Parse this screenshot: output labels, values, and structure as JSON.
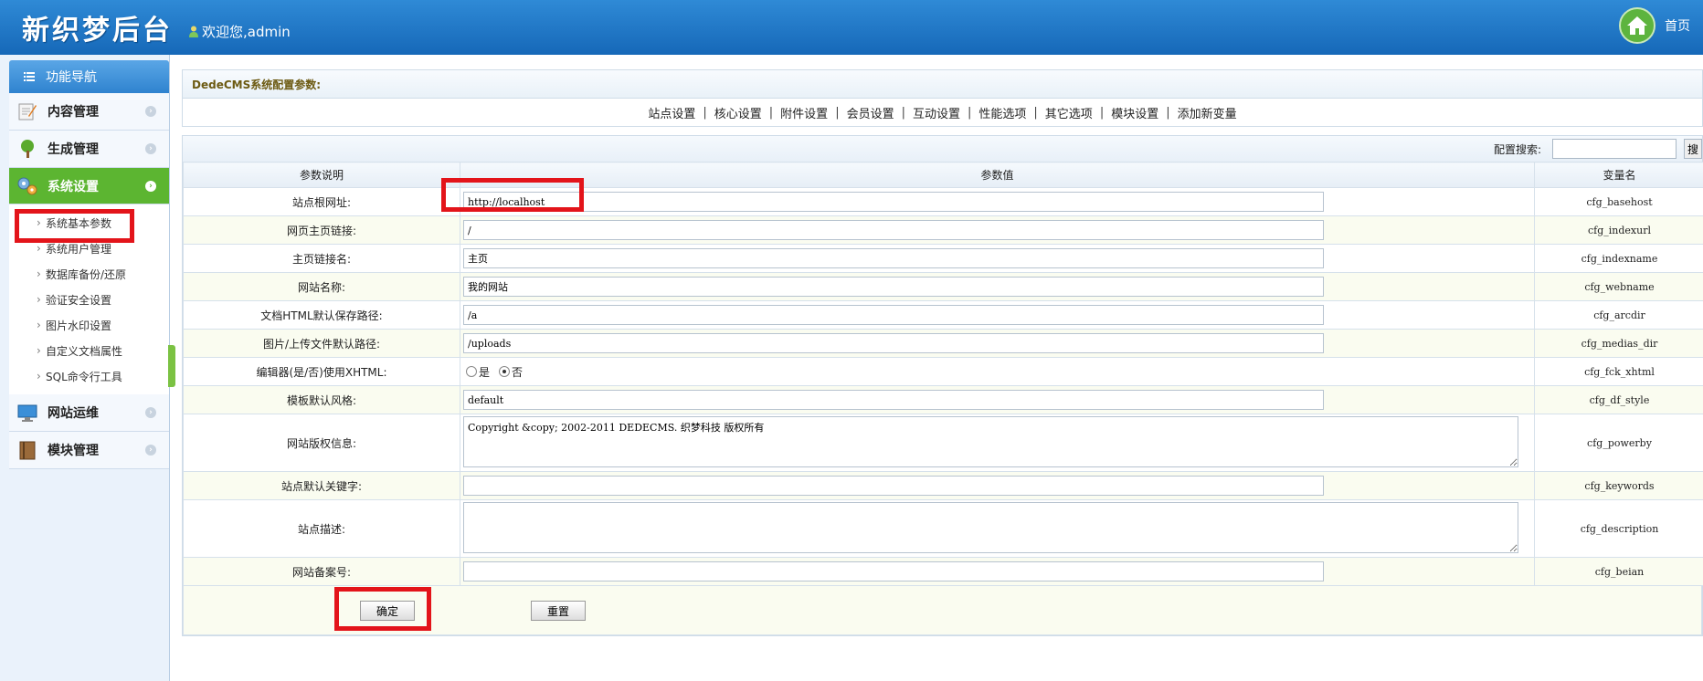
{
  "header": {
    "brand": "新织梦后台",
    "welcome": "欢迎您,admin",
    "home_label": "首页"
  },
  "sidebar": {
    "title": "功能导航",
    "items": [
      {
        "label": "内容管理",
        "icon": "notepad-icon"
      },
      {
        "label": "生成管理",
        "icon": "tree-icon"
      },
      {
        "label": "系统设置",
        "icon": "settings-icon"
      },
      {
        "label": "网站运维",
        "icon": "monitor-icon"
      },
      {
        "label": "模块管理",
        "icon": "book-icon"
      }
    ],
    "submenu": [
      "系统基本参数",
      "系统用户管理",
      "数据库备份/还原",
      "验证安全设置",
      "图片水印设置",
      "自定义文档属性",
      "SQL命令行工具"
    ]
  },
  "main": {
    "section_title": "DedeCMS系统配置参数:",
    "tabs": [
      "站点设置",
      "核心设置",
      "附件设置",
      "会员设置",
      "互动设置",
      "性能选项",
      "其它选项",
      "模块设置",
      "添加新变量"
    ],
    "search_label": "配置搜索:",
    "search_button": "搜",
    "columns": [
      "参数说明",
      "参数值",
      "变量名"
    ],
    "rows": [
      {
        "label": "站点根网址:",
        "value": "http://localhost",
        "var": "cfg_basehost"
      },
      {
        "label": "网页主页链接:",
        "value": "/",
        "var": "cfg_indexurl"
      },
      {
        "label": "主页链接名:",
        "value": "主页",
        "var": "cfg_indexname"
      },
      {
        "label": "网站名称:",
        "value": "我的网站",
        "var": "cfg_webname"
      },
      {
        "label": "文档HTML默认保存路径:",
        "value": "/a",
        "var": "cfg_arcdir"
      },
      {
        "label": "图片/上传文件默认路径:",
        "value": "/uploads",
        "var": "cfg_medias_dir"
      },
      {
        "label": "编辑器(是/否)使用XHTML:",
        "radio_yes": "是",
        "radio_no": "否",
        "selected": "否",
        "var": "cfg_fck_xhtml"
      },
      {
        "label": "模板默认风格:",
        "value": "default",
        "var": "cfg_df_style"
      },
      {
        "label": "网站版权信息:",
        "value": "Copyright &copy; 2002-2011 DEDECMS. 织梦科技 版权所有",
        "var": "cfg_powerby"
      },
      {
        "label": "站点默认关键字:",
        "value": "",
        "var": "cfg_keywords"
      },
      {
        "label": "站点描述:",
        "value": "",
        "var": "cfg_description"
      },
      {
        "label": "网站备案号:",
        "value": "",
        "var": "cfg_beian"
      }
    ],
    "submit_label": "确定",
    "reset_label": "重置"
  },
  "colors": {
    "topbar": "#1f78c8",
    "active_nav": "#5cb531",
    "highlight": "#e3141a"
  }
}
